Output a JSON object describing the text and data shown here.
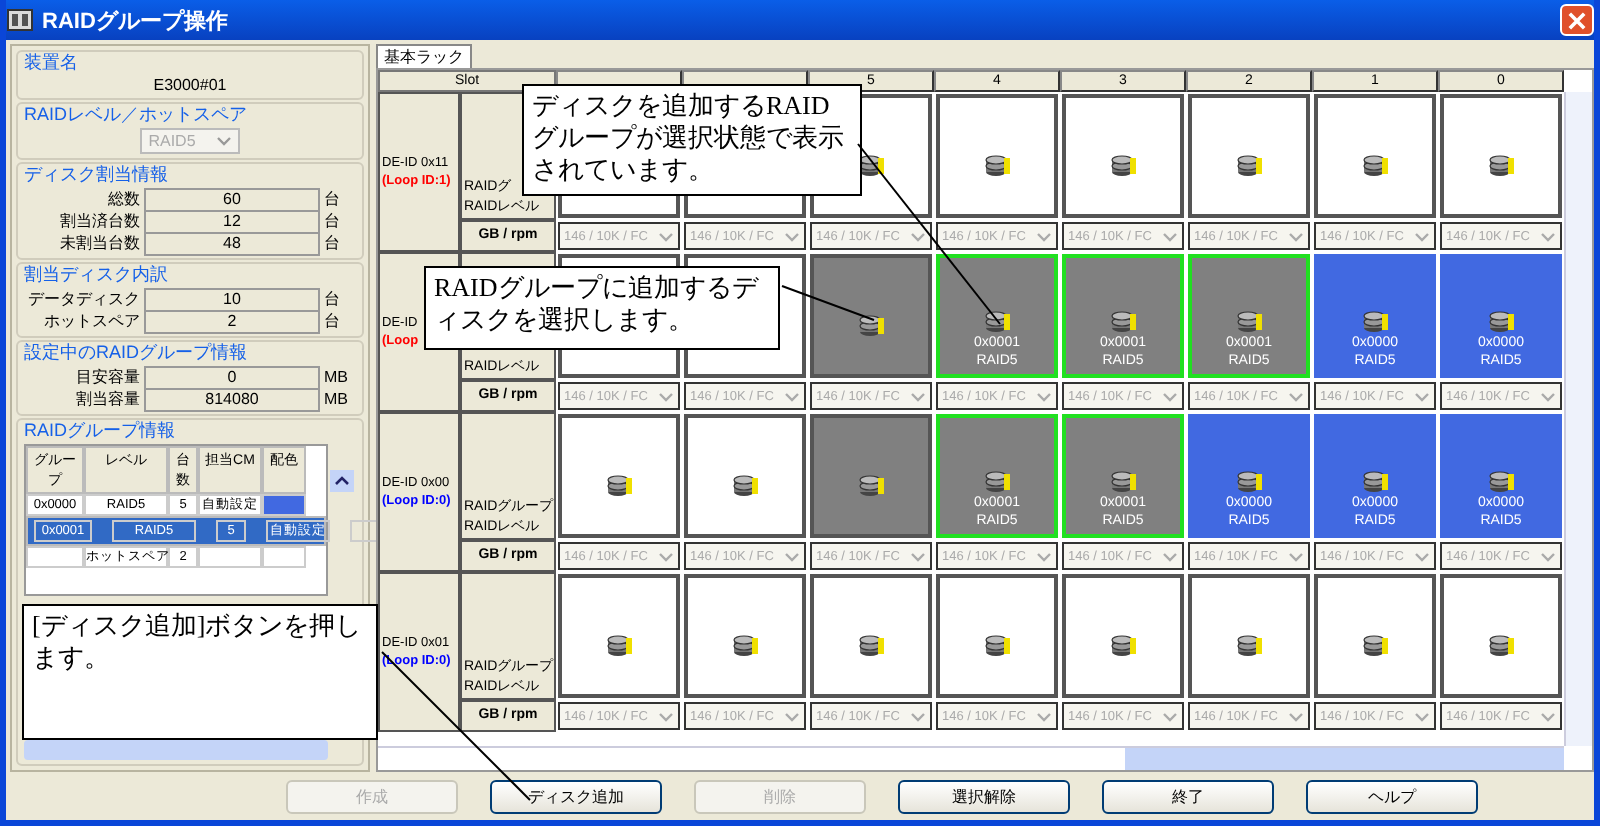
{
  "window": {
    "title": "RAIDグループ操作"
  },
  "left_panel": {
    "device": {
      "heading": "装置名",
      "value": "E3000#01"
    },
    "raid_level": {
      "heading": "RAIDレベル／ホットスペア",
      "value": "RAID5",
      "disabled": true
    },
    "allocation": {
      "heading": "ディスク割当情報",
      "rows": [
        {
          "label": "総数",
          "value": "60",
          "unit": "台"
        },
        {
          "label": "割当済台数",
          "value": "12",
          "unit": "台"
        },
        {
          "label": "未割当台数",
          "value": "48",
          "unit": "台"
        }
      ]
    },
    "breakdown": {
      "heading": "割当ディスク内訳",
      "rows": [
        {
          "label": "データディスク",
          "value": "10",
          "unit": "台"
        },
        {
          "label": "ホットスペア",
          "value": "2",
          "unit": "台"
        }
      ]
    },
    "current_group": {
      "heading": "設定中のRAIDグループ情報",
      "rows": [
        {
          "label": "目安容量",
          "value": "0",
          "unit": "MB"
        },
        {
          "label": "割当容量",
          "value": "814080",
          "unit": "MB"
        }
      ]
    },
    "group_table": {
      "heading": "RAIDグループ情報",
      "columns": [
        "グループ",
        "レベル",
        "台数",
        "担当CM",
        "配色"
      ],
      "rows": [
        {
          "group": "0x0000",
          "raid_level": "RAID5",
          "count": "5",
          "cm": "自動設定",
          "color": "#4169e1",
          "selected": false
        },
        {
          "group": "0x0001",
          "raid_level": "RAID5",
          "count": "5",
          "cm": "自動設定",
          "selected": true
        },
        {
          "raid_level": "ホットスペア",
          "count": "2",
          "selected": false
        }
      ]
    }
  },
  "rack": {
    "tab": {
      "label": "基本ラック",
      "selected": true
    },
    "slot_heading": "Slot",
    "slots": [
      "5",
      "4",
      "3",
      "2",
      "1",
      "0"
    ],
    "enclosures": [
      {
        "id": "DE-ID 0x11",
        "loop": "(Loop ID:1)",
        "color": "#ff0000",
        "group_label": "RAIDグ",
        "level_label": "RAIDレベル",
        "spec_label": "GB / rpm",
        "disks": [
          {
            "kind": "free",
            "spec": "146 / 10K / FC"
          },
          {
            "kind": "free",
            "spec": "146 / 10K / FC"
          },
          {
            "kind": "free",
            "spec": "146 / 10K / FC"
          },
          {
            "kind": "free",
            "spec": "146 / 10K / FC"
          },
          {
            "kind": "free",
            "spec": "146 / 10K / FC"
          },
          {
            "kind": "free",
            "spec": "146 / 10K / FC"
          },
          {
            "kind": "free",
            "spec": "146 / 10K / FC"
          },
          {
            "kind": "free",
            "spec": "146 / 10K / FC"
          }
        ]
      },
      {
        "id": "DE-ID",
        "loop": "(Loop",
        "color": "#ff0000",
        "level_label": "RAIDレベル",
        "spec_label": "GB / rpm",
        "disks": [
          {
            "kind": "free",
            "spec": "146 / 10K / FC"
          },
          {
            "kind": "free",
            "spec": "146 / 10K / FC"
          },
          {
            "kind": "candidate",
            "spec": "146 / 10K / FC"
          },
          {
            "kind": "member",
            "group": "0x0001",
            "raid_level": "RAID5",
            "spec": "146 / 10K / FC"
          },
          {
            "kind": "member",
            "group": "0x0001",
            "raid_level": "RAID5",
            "spec": "146 / 10K / FC"
          },
          {
            "kind": "member",
            "group": "0x0001",
            "raid_level": "RAID5",
            "spec": "146 / 10K / FC"
          },
          {
            "kind": "other",
            "group": "0x0000",
            "raid_level": "RAID5",
            "spec": "146 / 10K / FC"
          },
          {
            "kind": "other",
            "group": "0x0000",
            "raid_level": "RAID5",
            "spec": "146 / 10K / FC"
          }
        ]
      },
      {
        "id": "DE-ID 0x00",
        "loop": "(Loop ID:0)",
        "color": "#0000ff",
        "group_label": "RAIDグループ",
        "level_label": "RAIDレベル",
        "spec_label": "GB / rpm",
        "disks": [
          {
            "kind": "free",
            "spec": "146 / 10K / FC"
          },
          {
            "kind": "free",
            "spec": "146 / 10K / FC"
          },
          {
            "kind": "candidate",
            "spec": "146 / 10K / FC"
          },
          {
            "kind": "member",
            "group": "0x0001",
            "raid_level": "RAID5",
            "spec": "146 / 10K / FC"
          },
          {
            "kind": "member",
            "group": "0x0001",
            "raid_level": "RAID5",
            "spec": "146 / 10K / FC"
          },
          {
            "kind": "other",
            "group": "0x0000",
            "raid_level": "RAID5",
            "spec": "146 / 10K / FC"
          },
          {
            "kind": "other",
            "group": "0x0000",
            "raid_level": "RAID5",
            "spec": "146 / 10K / FC"
          },
          {
            "kind": "other",
            "group": "0x0000",
            "raid_level": "RAID5",
            "spec": "146 / 10K / FC"
          }
        ]
      },
      {
        "id": "DE-ID 0x01",
        "loop": "(Loop ID:0)",
        "color": "#0000ff",
        "group_label": "RAIDグループ",
        "level_label": "RAIDレベル",
        "spec_label": "GB / rpm",
        "disks": [
          {
            "kind": "free",
            "spec": "146 / 10K / FC"
          },
          {
            "kind": "free",
            "spec": "146 / 10K / FC"
          },
          {
            "kind": "free",
            "spec": "146 / 10K / FC"
          },
          {
            "kind": "free",
            "spec": "146 / 10K / FC"
          },
          {
            "kind": "free",
            "spec": "146 / 10K / FC"
          },
          {
            "kind": "free",
            "spec": "146 / 10K / FC"
          },
          {
            "kind": "free",
            "spec": "146 / 10K / FC"
          },
          {
            "kind": "free",
            "spec": "146 / 10K / FC"
          }
        ]
      }
    ]
  },
  "buttons": [
    {
      "label": "作成",
      "disabled": true
    },
    {
      "label": "ディスク追加",
      "disabled": false
    },
    {
      "label": "削除",
      "disabled": true
    },
    {
      "label": "選択解除",
      "disabled": false
    },
    {
      "label": "終了",
      "disabled": false
    },
    {
      "label": "ヘルプ",
      "disabled": false
    }
  ],
  "callouts": [
    {
      "text": "ディスクを追加するRAIDグループが選択状態で表示されています。"
    },
    {
      "text": "RAIDグループに追加するディスクを選択します。"
    },
    {
      "text": "[ディスク追加]ボタンを押します。"
    }
  ]
}
